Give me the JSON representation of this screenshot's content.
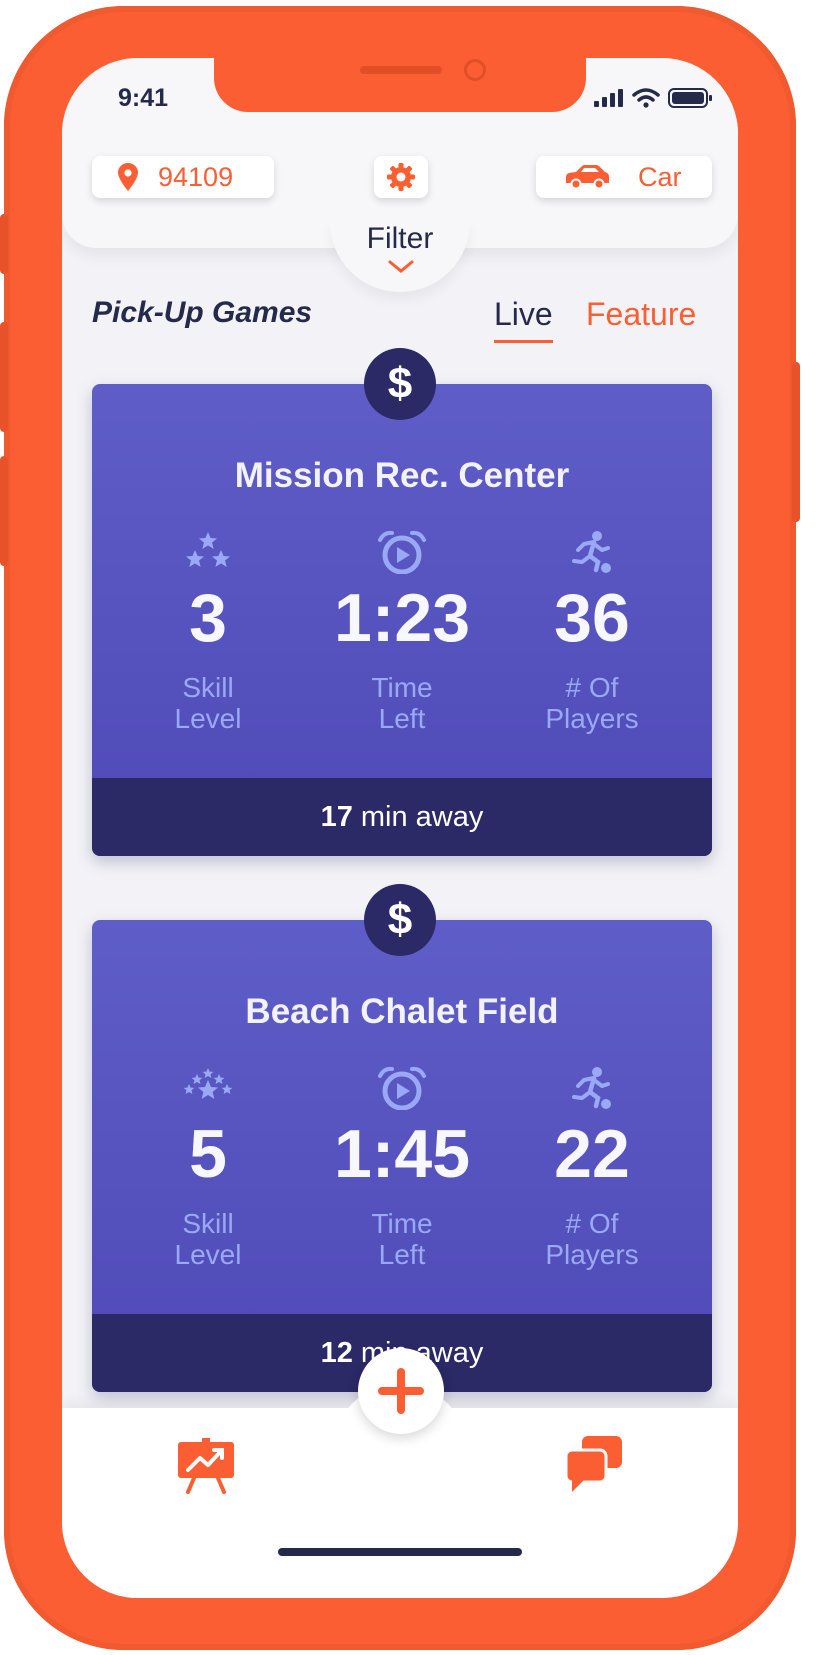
{
  "status_bar": {
    "time": "9:41"
  },
  "header": {
    "location_code": "94109",
    "transport_mode": "Car",
    "filter_label": "Filter"
  },
  "section": {
    "title": "Pick-Up Games",
    "tabs": [
      {
        "label": "Live",
        "active": true
      },
      {
        "label": "Feature",
        "active": false
      }
    ]
  },
  "games": [
    {
      "price_symbol": "$",
      "name": "Mission Rec. Center",
      "skill_level": "3",
      "time_left": "1:23",
      "players": "36",
      "skill_label_line1": "Skill",
      "skill_label_line2": "Level",
      "time_label_line1": "Time",
      "time_label_line2": "Left",
      "players_label_line1": "# Of",
      "players_label_line2": "Players",
      "distance_value": "17",
      "distance_text": "min away"
    },
    {
      "price_symbol": "$",
      "name": "Beach Chalet Field",
      "skill_level": "5",
      "time_left": "1:45",
      "players": "22",
      "skill_label_line1": "Skill",
      "skill_label_line2": "Level",
      "time_label_line1": "Time",
      "time_label_line2": "Left",
      "players_label_line1": "# Of",
      "players_label_line2": "Players",
      "distance_value": "12",
      "distance_text": "min away"
    }
  ],
  "icons": {
    "location": "map-pin-icon",
    "settings": "gear-icon",
    "transport": "car-icon",
    "skill": "stars-icon",
    "time": "alarm-clock-icon",
    "players": "soccer-player-icon",
    "add": "plus-icon",
    "stats": "presentation-chart-icon",
    "chat": "chat-bubbles-icon"
  },
  "colors": {
    "accent": "#fb5e32",
    "navy": "#252a4b",
    "card": "#5552c0",
    "card_footer": "#2b2966",
    "stat_label": "#9aa9f6"
  }
}
